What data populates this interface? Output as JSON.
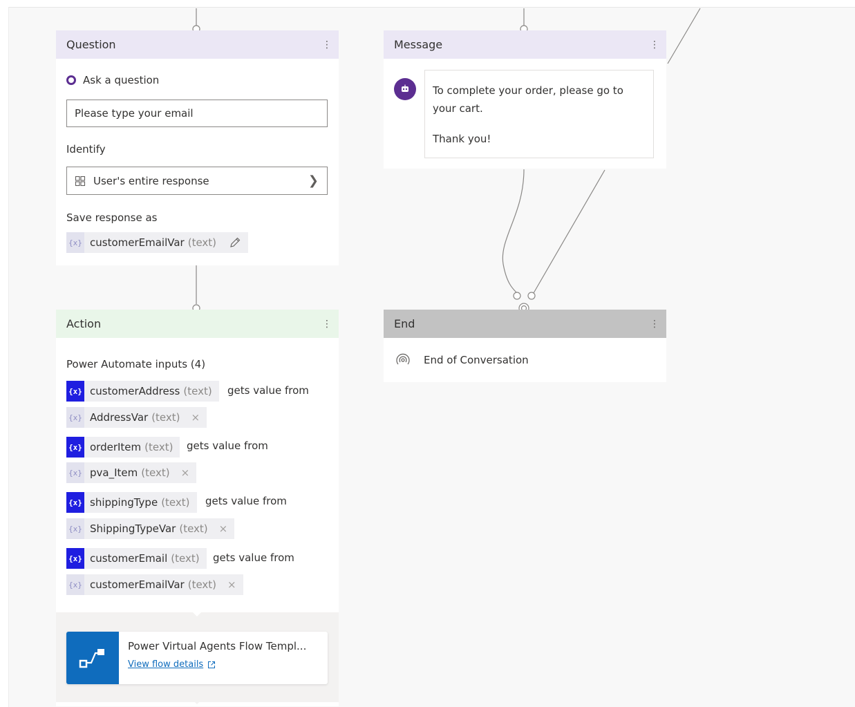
{
  "question": {
    "title": "Question",
    "ask_label": "Ask a question",
    "prompt_value": "Please type your email",
    "identify_label": "Identify",
    "identify_value": "User's entire response",
    "save_label": "Save response as",
    "save_var": {
      "name": "customerEmailVar",
      "type": "(text)"
    }
  },
  "message": {
    "title": "Message",
    "line1": "To complete your order, please go to",
    "line2": "your cart.",
    "line3": "Thank you!"
  },
  "action": {
    "title": "Action",
    "inputs_label": "Power Automate inputs (4)",
    "gets_text": "gets value from",
    "inputs": [
      {
        "param": "customerAddress",
        "param_type": "(text)",
        "var": "AddressVar",
        "var_type": "(text)"
      },
      {
        "param": "orderItem",
        "param_type": "(text)",
        "var": "pva_Item",
        "var_type": "(text)"
      },
      {
        "param": "shippingType",
        "param_type": "(text)",
        "var": "ShippingTypeVar",
        "var_type": "(text)"
      },
      {
        "param": "customerEmail",
        "param_type": "(text)",
        "var": "customerEmailVar",
        "var_type": "(text)"
      }
    ],
    "flow_name": "Power Virtual Agents Flow Templ...",
    "flow_link": "View flow details"
  },
  "end": {
    "title": "End",
    "text": "End of Conversation"
  },
  "colors": {
    "accent_purple": "#5c2e91",
    "var_blue": "#1f1ee0",
    "flow_blue": "#0f6cbd",
    "end_header": "#c2c2c2"
  }
}
